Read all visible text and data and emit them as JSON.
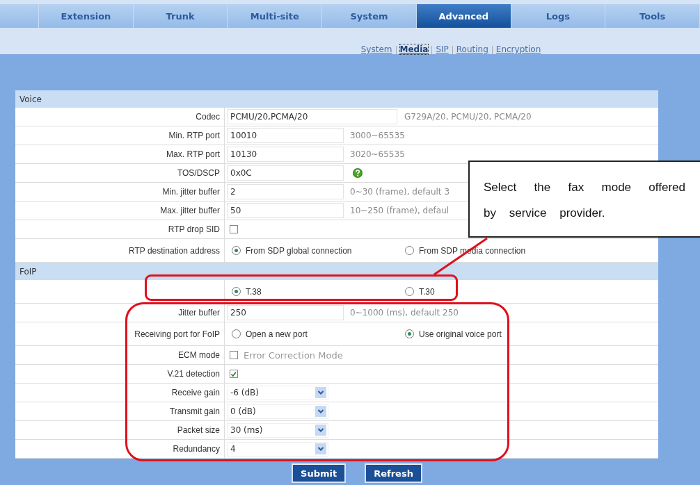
{
  "nav_tabs": [
    {
      "label": "Extension",
      "selected": false
    },
    {
      "label": "Trunk",
      "selected": false
    },
    {
      "label": "Multi-site",
      "selected": false
    },
    {
      "label": "System",
      "selected": false
    },
    {
      "label": "Advanced",
      "selected": true
    },
    {
      "label": "Logs",
      "selected": false
    },
    {
      "label": "Tools",
      "selected": false
    }
  ],
  "sub_nav": [
    {
      "label": "System",
      "selected": false
    },
    {
      "label": "Media",
      "selected": true
    },
    {
      "label": "SIP",
      "selected": false
    },
    {
      "label": "Routing",
      "selected": false
    },
    {
      "label": "Encryption",
      "selected": false
    }
  ],
  "sections": [
    {
      "title": "Voice",
      "rows": [
        {
          "kind": "wide-text",
          "label": "Codec",
          "value": "PCMU/20,PCMA/20",
          "hint": "G729A/20, PCMU/20, PCMA/20"
        },
        {
          "kind": "text",
          "label": "Min. RTP port",
          "value": "10010",
          "hint": "3000~65535"
        },
        {
          "kind": "text",
          "label": "Max. RTP port",
          "value": "10130",
          "hint": "3020~65535"
        },
        {
          "kind": "text-help",
          "label": "TOS/DSCP",
          "value": "0x0C"
        },
        {
          "kind": "text",
          "label": "Min. jitter buffer",
          "value": "2",
          "hint": "0~30 (frame), default 3"
        },
        {
          "kind": "text",
          "label": "Max. jitter buffer",
          "value": "50",
          "hint": "10~250 (frame), defaul"
        },
        {
          "kind": "checkbox",
          "label": "RTP drop SID",
          "checked": false
        },
        {
          "kind": "radio",
          "label": "RTP destination address",
          "options": [
            {
              "label": "From SDP global connection",
              "selected": true
            },
            {
              "label": "From SDP media connection",
              "selected": false
            }
          ]
        }
      ]
    },
    {
      "title": "FoIP",
      "rows": [
        {
          "kind": "radio",
          "options": [
            {
              "label": "T.38",
              "selected": true
            },
            {
              "label": "T.30",
              "selected": false
            }
          ]
        },
        {
          "kind": "text",
          "label": "Jitter buffer",
          "value": "250",
          "hint": "0~1000 (ms), default 250"
        },
        {
          "kind": "radio",
          "label": "Receiving port for FoIP",
          "options": [
            {
              "label": "Open a new port",
              "selected": false
            },
            {
              "label": "Use original voice port",
              "selected": true
            }
          ]
        },
        {
          "kind": "checkbox",
          "label": "ECM mode",
          "checked": false,
          "caption": "Error Correction Mode"
        },
        {
          "kind": "checkbox",
          "label": "V.21 detection",
          "checked": true
        },
        {
          "kind": "select",
          "label": "Receive gain",
          "value": "-6 (dB)"
        },
        {
          "kind": "select",
          "label": "Transmit gain",
          "value": "0 (dB)"
        },
        {
          "kind": "select",
          "label": "Packet size",
          "value": "30 (ms)"
        },
        {
          "kind": "select",
          "label": "Redundancy",
          "value": "4"
        }
      ]
    }
  ],
  "buttons": [
    "Submit",
    "Refresh"
  ],
  "callout": {
    "text": "Select the fax mode offered by service provider."
  }
}
